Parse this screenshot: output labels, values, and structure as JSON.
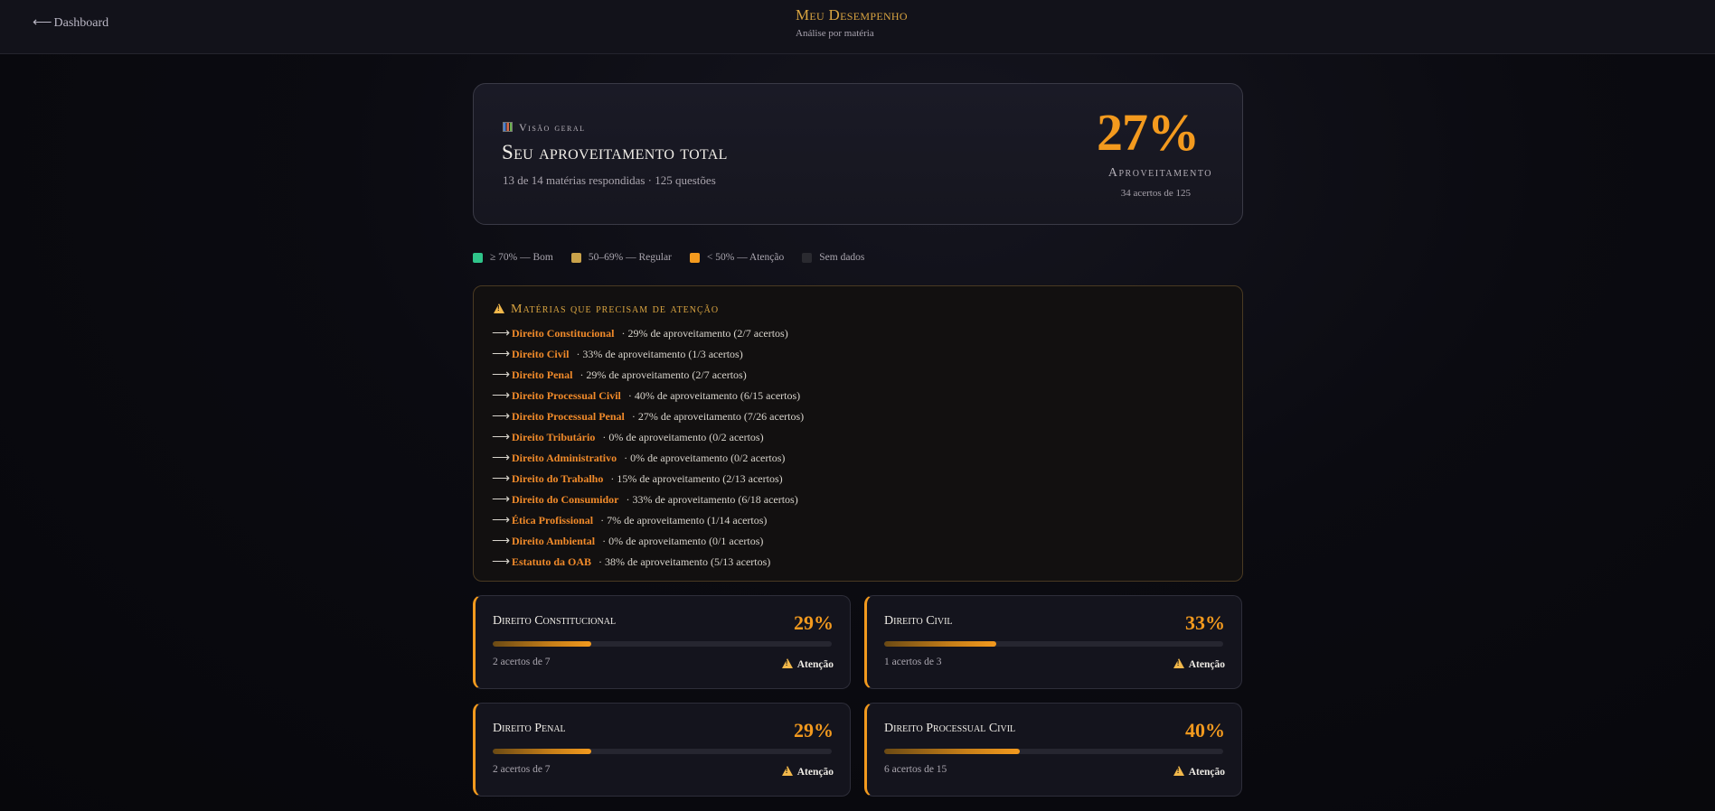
{
  "header": {
    "back_label": "Dashboard",
    "title": "Meu Desempenho",
    "subtitle": "Análise por matéria"
  },
  "overview": {
    "label": "Visão geral",
    "title": "Seu aproveitamento total",
    "subtitle": "13 de 14 matérias respondidas · 125 questões",
    "percent": "27%",
    "percent_label": "Aproveitamento",
    "detail": "34 acertos de 125"
  },
  "legend": [
    {
      "label": "≥ 70% — Bom",
      "color": "#2fc48a"
    },
    {
      "label": "50–69% — Regular",
      "color": "#c9a24a"
    },
    {
      "label": "< 50% — Atenção",
      "color": "#f39a1e"
    },
    {
      "label": "Sem dados",
      "color": "#2a2a30"
    }
  ],
  "attention": {
    "title": "Matérias que precisam de atenção",
    "items": [
      {
        "name": "Direito Constitucional",
        "detail": "· 29% de aproveitamento (2/7 acertos)"
      },
      {
        "name": "Direito Civil",
        "detail": "· 33% de aproveitamento (1/3 acertos)"
      },
      {
        "name": "Direito Penal",
        "detail": "· 29% de aproveitamento (2/7 acertos)"
      },
      {
        "name": "Direito Processual Civil",
        "detail": "· 40% de aproveitamento (6/15 acertos)"
      },
      {
        "name": "Direito Processual Penal",
        "detail": "· 27% de aproveitamento (7/26 acertos)"
      },
      {
        "name": "Direito Tributário",
        "detail": "· 0% de aproveitamento (0/2 acertos)"
      },
      {
        "name": "Direito Administrativo",
        "detail": "· 0% de aproveitamento (0/2 acertos)"
      },
      {
        "name": "Direito do Trabalho",
        "detail": "· 15% de aproveitamento (2/13 acertos)"
      },
      {
        "name": "Direito do Consumidor",
        "detail": "· 33% de aproveitamento (6/18 acertos)"
      },
      {
        "name": "Ética Profissional",
        "detail": "· 7% de aproveitamento (1/14 acertos)"
      },
      {
        "name": "Direito Ambiental",
        "detail": "· 0% de aproveitamento (0/1 acertos)"
      },
      {
        "name": "Estatuto da OAB",
        "detail": "· 38% de aproveitamento (5/13 acertos)"
      }
    ]
  },
  "cards": [
    {
      "name": "Direito Constitucional",
      "percent": "29%",
      "progress": 0.29,
      "detail": "2 acertos de 7",
      "status": "Atenção"
    },
    {
      "name": "Direito Civil",
      "percent": "33%",
      "progress": 0.33,
      "detail": "1 acertos de 3",
      "status": "Atenção"
    },
    {
      "name": "Direito Penal",
      "percent": "29%",
      "progress": 0.29,
      "detail": "2 acertos de 7",
      "status": "Atenção"
    },
    {
      "name": "Direito Processual Civil",
      "percent": "40%",
      "progress": 0.4,
      "detail": "6 acertos de 15",
      "status": "Atenção"
    }
  ]
}
